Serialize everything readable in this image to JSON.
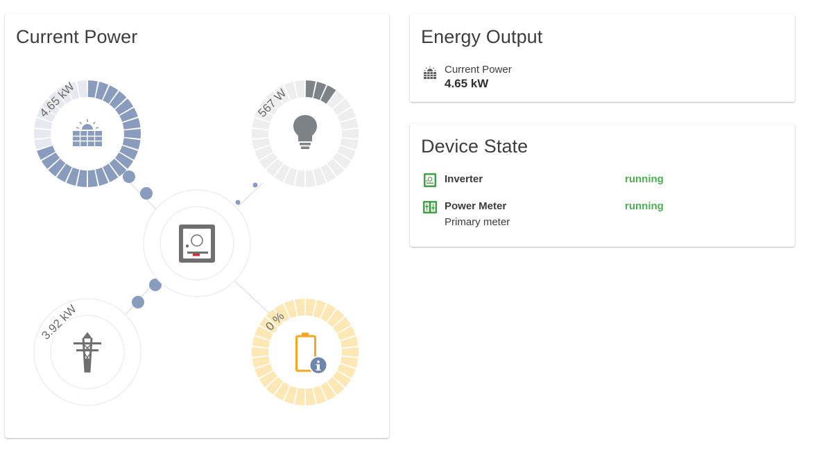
{
  "colors": {
    "solar": "#8a9cbd",
    "consumption": "#7e8388",
    "battery": "#f5a623",
    "battery_ring": "#fde7b5",
    "ring_empty": "#eeeeee",
    "status_running": "#4caf50",
    "device_icon": "#43a047"
  },
  "current_power": {
    "title": "Current Power",
    "solar": {
      "value": "4.65 kW",
      "fraction": 0.7,
      "icon": "solar-panel-icon"
    },
    "consumption": {
      "value": "567 W",
      "fraction": 0.1,
      "icon": "lightbulb-icon"
    },
    "grid": {
      "value": "3.92 kW",
      "fraction": 0,
      "icon": "power-tower-icon"
    },
    "battery": {
      "value": "0 %",
      "fraction": 0,
      "icon": "battery-icon",
      "badge_icon": "info-icon"
    },
    "inverter": {
      "icon": "inverter-icon"
    }
  },
  "energy_output": {
    "title": "Energy Output",
    "items": [
      {
        "label": "Current Power",
        "value": "4.65 kW",
        "icon": "solar-panel-icon"
      }
    ]
  },
  "device_state": {
    "title": "Device State",
    "items": [
      {
        "name": "Inverter",
        "detail": "",
        "status": "running",
        "icon": "inverter-icon"
      },
      {
        "name": "Power Meter",
        "detail": "Primary meter",
        "status": "running",
        "icon": "power-meter-icon"
      }
    ]
  }
}
